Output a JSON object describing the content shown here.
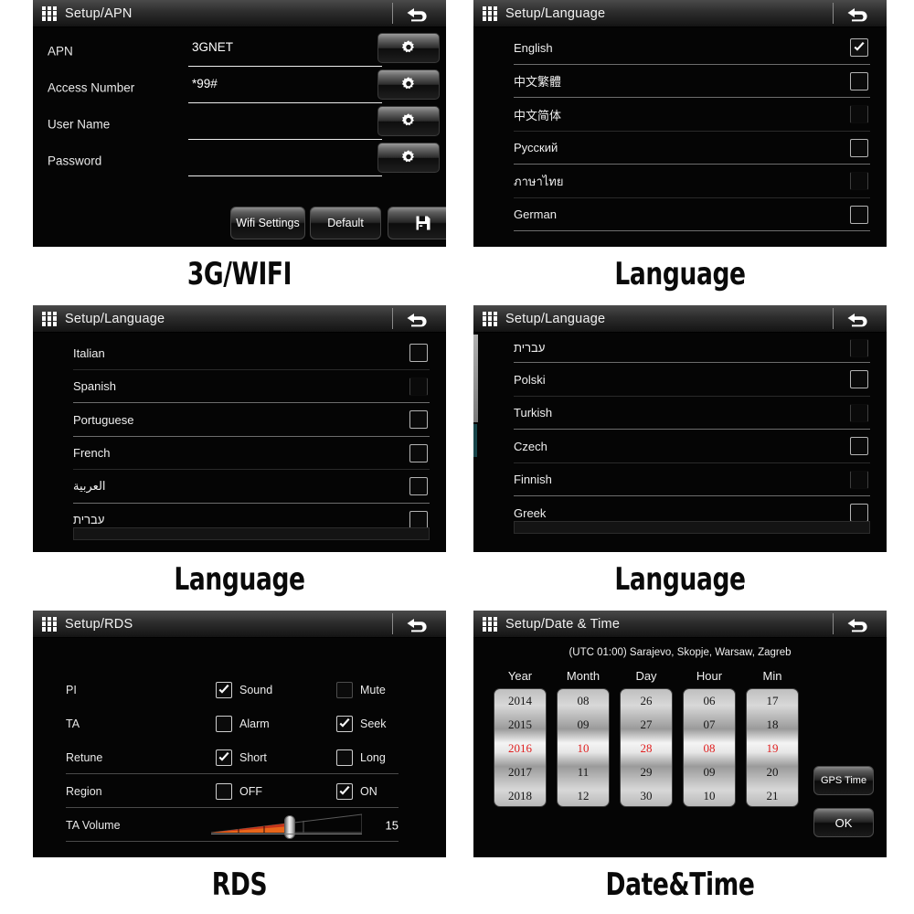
{
  "panels": {
    "apn": {
      "title": "Setup/APN",
      "caption": "3G/WIFI",
      "fields": [
        {
          "label": "APN",
          "value": "3GNET"
        },
        {
          "label": "Access Number",
          "value": "*99#"
        },
        {
          "label": "User Name",
          "value": ""
        },
        {
          "label": "Password",
          "value": ""
        }
      ],
      "buttons": {
        "wifi": "Wifi Settings",
        "default": "Default",
        "save": "save-icon"
      }
    },
    "language1": {
      "title": "Setup/Language",
      "caption": "Language",
      "items": [
        {
          "label": "English",
          "checked": true
        },
        {
          "label": "中文繁體",
          "checked": false
        },
        {
          "label": "中文简体",
          "checked": false
        },
        {
          "label": "Русский",
          "checked": false
        },
        {
          "label": "ภาษาไทย",
          "checked": false
        },
        {
          "label": "German",
          "checked": false
        }
      ]
    },
    "language2": {
      "title": "Setup/Language",
      "caption": "Language",
      "items": [
        {
          "label": "Italian",
          "checked": false
        },
        {
          "label": "Spanish",
          "checked": false
        },
        {
          "label": "Portuguese",
          "checked": false
        },
        {
          "label": "French",
          "checked": false
        },
        {
          "label": "العربية",
          "checked": false
        },
        {
          "label": "עברית",
          "checked": false
        }
      ]
    },
    "language3": {
      "title": "Setup/Language",
      "caption": "Language",
      "items": [
        {
          "label": "עברית",
          "checked": false
        },
        {
          "label": "Polski",
          "checked": false
        },
        {
          "label": "Turkish",
          "checked": false
        },
        {
          "label": "Czech",
          "checked": false
        },
        {
          "label": "Finnish",
          "checked": false
        },
        {
          "label": "Greek",
          "checked": false
        }
      ]
    },
    "rds": {
      "title": "Setup/RDS",
      "caption": "RDS",
      "rows": [
        {
          "name": "PI",
          "a": {
            "label": "Sound",
            "checked": true
          },
          "b": {
            "label": "Mute",
            "checked": false
          }
        },
        {
          "name": "TA",
          "a": {
            "label": "Alarm",
            "checked": false
          },
          "b": {
            "label": "Seek",
            "checked": true
          }
        },
        {
          "name": "Retune",
          "a": {
            "label": "Short",
            "checked": true
          },
          "b": {
            "label": "Long",
            "checked": false
          }
        },
        {
          "name": "Region",
          "a": {
            "label": "OFF",
            "checked": false
          },
          "b": {
            "label": "ON",
            "checked": true
          }
        }
      ],
      "volume": {
        "name": "TA Volume",
        "value": "15",
        "percent": 47
      }
    },
    "datetime": {
      "title": "Setup/Date & Time",
      "caption": "Date&Time",
      "timezone": "(UTC  01:00) Sarajevo, Skopje, Warsaw, Zagreb",
      "columns": [
        {
          "head": "Year",
          "values": [
            "2014",
            "2015",
            "2016",
            "2017",
            "2018"
          ],
          "selected": "2016"
        },
        {
          "head": "Month",
          "values": [
            "08",
            "09",
            "10",
            "11",
            "12"
          ],
          "selected": "10"
        },
        {
          "head": "Day",
          "values": [
            "26",
            "27",
            "28",
            "29",
            "30"
          ],
          "selected": "28"
        },
        {
          "head": "Hour",
          "values": [
            "06",
            "07",
            "08",
            "09",
            "10"
          ],
          "selected": "08"
        },
        {
          "head": "Min",
          "values": [
            "17",
            "18",
            "19",
            "20",
            "21"
          ],
          "selected": "19"
        }
      ],
      "buttons": {
        "gps": "GPS Time",
        "ok": "OK"
      }
    }
  },
  "colors": {
    "accent_red": "#e02020",
    "slider_orange": "#e8661a",
    "panel_bg": "#060606",
    "text": "#efefef"
  }
}
